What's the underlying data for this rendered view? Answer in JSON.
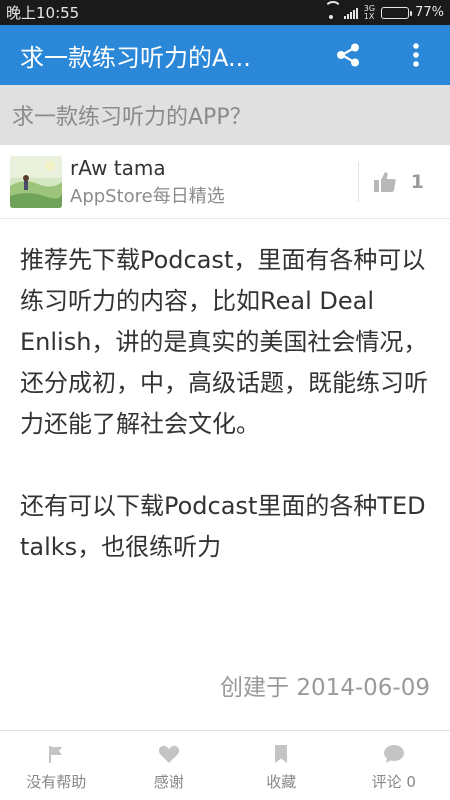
{
  "status_bar": {
    "time": "晚上10:55",
    "network_type_top": "3G",
    "network_type_bottom": "1X",
    "battery_text": "77%",
    "battery_level": 0.77
  },
  "app_bar": {
    "title": "求一款练习听力的A...",
    "share_icon": "share-icon",
    "more_icon": "more-vert-icon",
    "color": "#2b87d8"
  },
  "question": {
    "title": "求一款练习听力的APP？"
  },
  "answer": {
    "author_name": "rAw tama",
    "author_desc": "AppStore每日精选",
    "votes": "1",
    "paragraphs": [
      "推荐先下载Podcast，里面有各种可以练习听力的内容，比如Real Deal Enlish，讲的是真实的美国社会情况，还分成初，中，高级话题，既能练习听力还能了解社会文化。",
      "还有可以下载Podcast里面的各种TED talks，也很练听力"
    ],
    "created": "创建于 2014-06-09"
  },
  "bottom_bar": {
    "items": [
      {
        "label": "没有帮助",
        "icon": "flag-icon"
      },
      {
        "label": "感谢",
        "icon": "heart-icon"
      },
      {
        "label": "收藏",
        "icon": "bookmark-icon"
      },
      {
        "label": "评论 0",
        "icon": "comment-icon"
      }
    ]
  }
}
